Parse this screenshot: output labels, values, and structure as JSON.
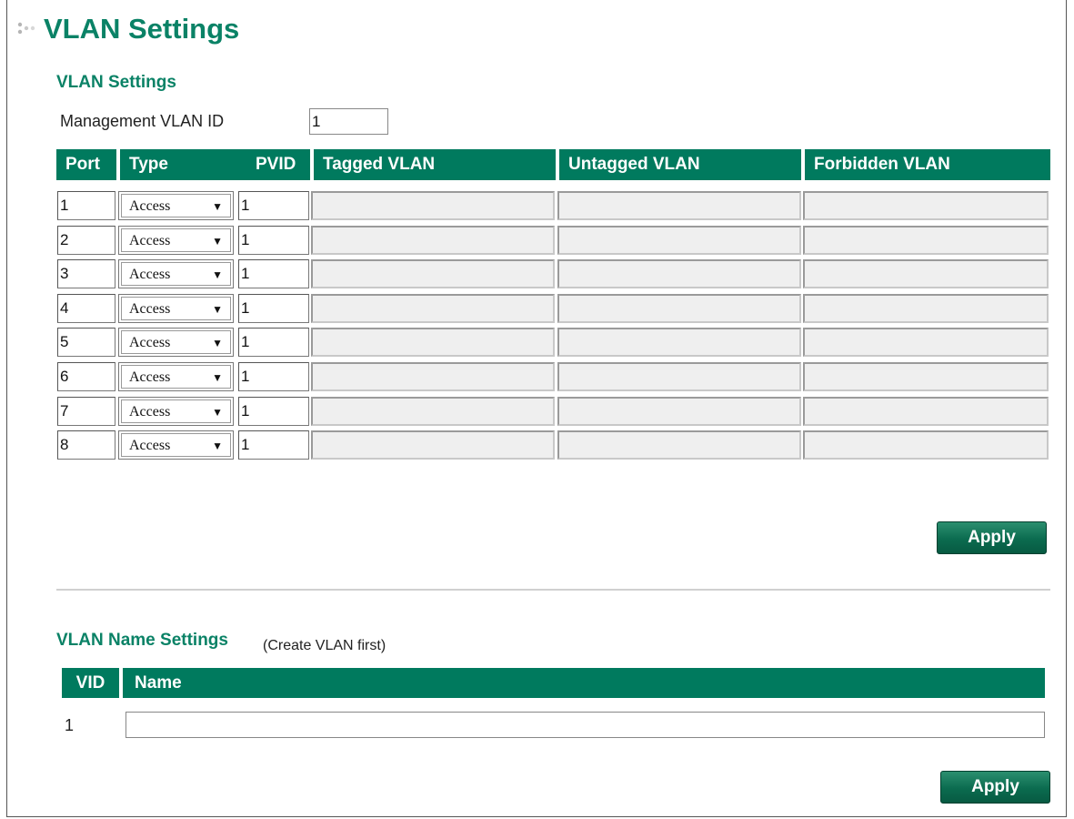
{
  "page": {
    "title": "VLAN Settings"
  },
  "vlan_settings": {
    "heading": "VLAN Settings",
    "management_vlan_label": "Management VLAN ID",
    "management_vlan_value": "1",
    "columns": [
      "Port",
      "Type",
      "PVID",
      "Tagged VLAN",
      "Untagged VLAN",
      "Forbidden VLAN"
    ],
    "rows": [
      {
        "port": "1",
        "type": "Access",
        "pvid": "1",
        "tagged": "",
        "untagged": "",
        "forbidden": ""
      },
      {
        "port": "2",
        "type": "Access",
        "pvid": "1",
        "tagged": "",
        "untagged": "",
        "forbidden": ""
      },
      {
        "port": "3",
        "type": "Access",
        "pvid": "1",
        "tagged": "",
        "untagged": "",
        "forbidden": ""
      },
      {
        "port": "4",
        "type": "Access",
        "pvid": "1",
        "tagged": "",
        "untagged": "",
        "forbidden": ""
      },
      {
        "port": "5",
        "type": "Access",
        "pvid": "1",
        "tagged": "",
        "untagged": "",
        "forbidden": ""
      },
      {
        "port": "6",
        "type": "Access",
        "pvid": "1",
        "tagged": "",
        "untagged": "",
        "forbidden": ""
      },
      {
        "port": "7",
        "type": "Access",
        "pvid": "1",
        "tagged": "",
        "untagged": "",
        "forbidden": ""
      },
      {
        "port": "8",
        "type": "Access",
        "pvid": "1",
        "tagged": "",
        "untagged": "",
        "forbidden": ""
      }
    ],
    "apply_label": "Apply"
  },
  "vlan_name_settings": {
    "heading": "VLAN Name Settings",
    "note": "(Create VLAN first)",
    "columns": [
      "VID",
      "Name"
    ],
    "rows": [
      {
        "vid": "1",
        "name": ""
      }
    ],
    "apply_label": "Apply"
  },
  "colors": {
    "accent": "#0a8266",
    "header_bg": "#007a5e"
  }
}
